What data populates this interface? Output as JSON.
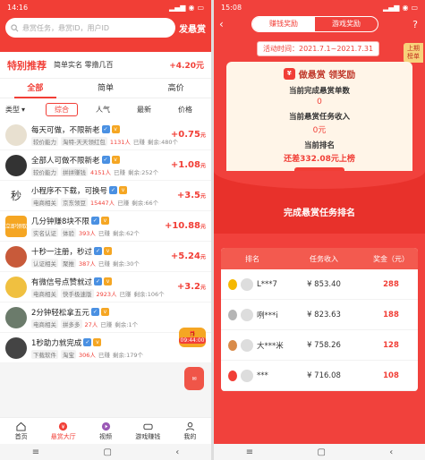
{
  "left": {
    "status": {
      "time": "14:16"
    },
    "search": {
      "placeholder": "悬赏任务，悬赏ID，用户ID",
      "publish_label": "发悬赏"
    },
    "special": {
      "title": "特别推荐",
      "subtitle": "简单实名 零撸几百",
      "price": "+4.20元"
    },
    "filter_tabs": [
      "全部",
      "简单",
      "高价"
    ],
    "sort_tabs": {
      "type": "类型",
      "items": [
        "综合",
        "人气",
        "最新",
        "价格"
      ]
    },
    "items": [
      {
        "title": "每天可做，不限新老",
        "tag1": "较价能力",
        "tag2": "淘特-天天领红包",
        "done": "1131人",
        "done_suffix": "已赚",
        "remain": "剩余:480个",
        "price": "+0.75",
        "unit": "元",
        "avatar_color": "#e8e0d0"
      },
      {
        "title": "全部人可做不限新老",
        "tag1": "较价能力",
        "tag2": "拼拼赚钱",
        "done": "4151人",
        "done_suffix": "已赚",
        "remain": "剩余:252个",
        "price": "+1.08",
        "unit": "元",
        "avatar_color": "#333333"
      },
      {
        "title": "小程序不下载，可换号",
        "tag1": "电商相关",
        "tag2": "京东领豆",
        "done": "15447人",
        "done_suffix": "已赚",
        "remain": "剩余:66个",
        "price": "+3.5",
        "unit": "元",
        "avatar_text": "秒",
        "avatar_color": "#ffffff"
      },
      {
        "title": "几分钟赚8块不限",
        "tag1": "实名认证",
        "tag2": "体验",
        "done": "393人",
        "done_suffix": "已赚",
        "remain": "剩余:62个",
        "price": "+10.88",
        "unit": "元",
        "avatar_text": "立即领取",
        "avatar_color": "#f5a623"
      },
      {
        "title": "十秒一注册，秒过",
        "tag1": "认证相关",
        "tag2": "聚推",
        "done": "387人",
        "done_suffix": "已赚",
        "remain": "剩余:30个",
        "price": "+5.24",
        "unit": "元",
        "avatar_color": "#c85a3a"
      },
      {
        "title": "有微信号点赞就过",
        "tag1": "电商相关",
        "tag2": "快手极速版",
        "done": "2923人",
        "done_suffix": "已赚",
        "remain": "剩余:106个",
        "price": "+3.2",
        "unit": "元",
        "avatar_color": "#f0c040"
      },
      {
        "title": "2分钟轻松拿五元",
        "tag1": "电商相关",
        "tag2": "拼多多",
        "done": "27人",
        "done_suffix": "已赚",
        "remain": "剩余:1个",
        "price": "",
        "unit": "",
        "avatar_color": "#6b7b6b"
      },
      {
        "title": "1秒助力就完成",
        "tag1": "下载软件",
        "tag2": "淘宝",
        "done": "306人",
        "done_suffix": "已赚",
        "remain": "剩余:179个",
        "price": "",
        "unit": "",
        "avatar_color": "#444444"
      }
    ],
    "float_timer": "09:44:00",
    "bottom_nav": [
      "首页",
      "悬赏大厅",
      "视频",
      "游戏赚钱",
      "我的"
    ]
  },
  "right": {
    "status": {
      "time": "15:08"
    },
    "tabs": [
      "赚钱奖励",
      "游戏奖励"
    ],
    "period": "活动时间：2021.7.1~2021.7.31",
    "rank_tag": "上期榜单",
    "card": {
      "title": "做悬赏 领奖励",
      "done_label": "当前完成悬赏单数",
      "done_value": "0",
      "income_label": "当前悬赏任务收入",
      "income_value": "0元",
      "rank_label": "当前排名",
      "rank_value": "还差332.08元上榜",
      "btn": "立即赚钱"
    },
    "rank_title": "完成悬赏任务排名",
    "table_headers": [
      "排名",
      "任务收入",
      "奖金（元）"
    ],
    "rows": [
      {
        "name": "L***7",
        "income": "¥ 853.40",
        "bonus": "288",
        "medal": "#f5b800"
      },
      {
        "name": "咧***i",
        "income": "¥ 823.63",
        "bonus": "188",
        "medal": "#b5b5b5"
      },
      {
        "name": "大***米",
        "income": "¥ 758.26",
        "bonus": "128",
        "medal": "#d98b4a"
      },
      {
        "name": "***",
        "income": "¥ 716.08",
        "bonus": "108",
        "medal": "#f13e36"
      }
    ]
  }
}
